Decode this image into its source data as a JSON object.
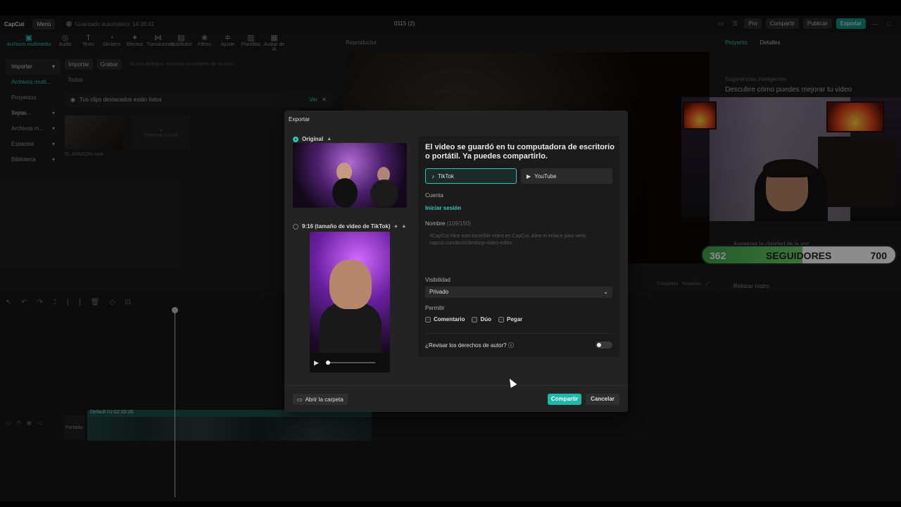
{
  "titlebar": {
    "logo": "CapCut",
    "menu": "Menú",
    "autosave": "Guardado automático: 14:38:41",
    "project": "0115 (2)",
    "pro": "Pro",
    "share": "Compartir",
    "publish": "Publicar",
    "export": "Exportar"
  },
  "toolbar": [
    {
      "label": "Archivos multimedia",
      "icon": "media-icon"
    },
    {
      "label": "Audio",
      "icon": "audio-icon"
    },
    {
      "label": "Texto",
      "icon": "text-icon"
    },
    {
      "label": "Stickers",
      "icon": "sticker-icon"
    },
    {
      "label": "Efectos",
      "icon": "effects-icon"
    },
    {
      "label": "Transiciones",
      "icon": "transition-icon"
    },
    {
      "label": "Subtítulos",
      "icon": "subtitle-icon"
    },
    {
      "label": "Filtros",
      "icon": "filter-icon"
    },
    {
      "label": "Ajuste",
      "icon": "adjust-icon"
    },
    {
      "label": "Plantillas",
      "icon": "template-icon"
    },
    {
      "label": "Avatar de IA",
      "icon": "avatar-icon"
    }
  ],
  "sidebar": {
    "items": [
      {
        "label": "Importar"
      },
      {
        "label": "Archivos multi..."
      },
      {
        "label": "Proyectos secun..."
      },
      {
        "label": "Tuyos"
      },
      {
        "label": "Archivos m..."
      },
      {
        "label": "Espacios"
      },
      {
        "label": "Biblioteca"
      }
    ]
  },
  "media": {
    "import": "Importar",
    "record": "Grabar",
    "search_placeholder": "Busca diálogos, escenas o nombres de archivo",
    "all": "Todos",
    "banner": "Tus clips destacados están listos",
    "banner_action": "Ver",
    "clip_name": "EL APAGON.mp4",
    "ai_label": "Generar con IA"
  },
  "player": {
    "title": "Reproductor",
    "complete": "Completa",
    "ratio": "Relación"
  },
  "right_panel": {
    "tab_project": "Proyecto",
    "tab_details": "Detalles",
    "suggest_title": "Sugerencias inteligentes",
    "suggest_sub": "Descubre cómo puedes mejorar tu video",
    "item_voice": "Aumentar la claridad de la voz",
    "item_face": "Retocar rostro"
  },
  "followers": {
    "current": "362",
    "label": "SEGUIDORES",
    "goal": "700",
    "progress": 0.517
  },
  "timeline": {
    "clip_label": "Default  01:02:33:26",
    "cover": "Portada"
  },
  "export_dialog": {
    "title": "Exportar",
    "option_original": "Original",
    "option_vertical": "9:16 (tamaño de video de TikTok)",
    "saved_message": "El video se guardó en tu computadora de escritorio o portátil. Ya puedes compartirlo.",
    "platform_tiktok": "TikTok",
    "platform_youtube": "YouTube",
    "account_label": "Cuenta",
    "login_link": "Iniciar sesión",
    "name_label": "Nombre",
    "name_counter": "(109/150)",
    "name_value": "#CapCut Hice este increíble video en CapCut. Abre el enlace para verlo: capcut.com/tools/desktop-video-editor",
    "visibility_label": "Visibilidad",
    "visibility_value": "Privado",
    "allow_label": "Permitir",
    "allow_comment": "Comentario",
    "allow_duo": "Dúo",
    "allow_stitch": "Pegar",
    "copyright_check": "¿Revisar los derechos de autor?",
    "open_folder": "Abrir la carpeta",
    "share": "Compartir",
    "cancel": "Cancelar"
  }
}
